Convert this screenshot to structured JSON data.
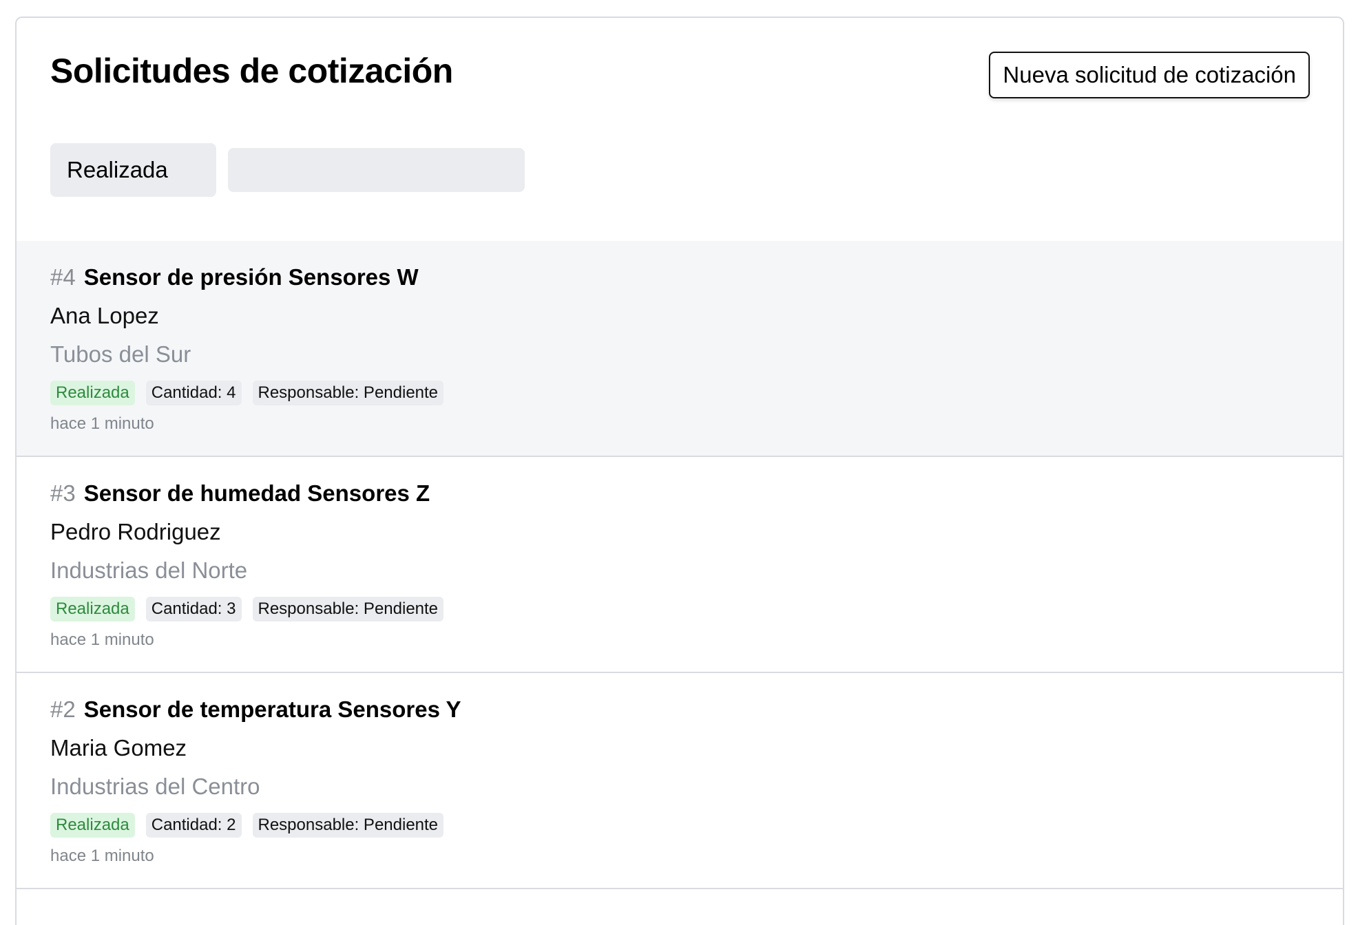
{
  "header": {
    "title": "Solicitudes de cotización",
    "new_button_label": "Nueva solicitud de cotización"
  },
  "filters": {
    "status_selected": "Realizada",
    "search_value": "",
    "search_placeholder": ""
  },
  "items": [
    {
      "number": "#4",
      "title": "Sensor de presión Sensores W",
      "person": "Ana Lopez",
      "company": "Tubos del Sur",
      "status": "Realizada",
      "quantity": "Cantidad: 4",
      "responsible": "Responsable: Pendiente",
      "time": "hace 1 minuto"
    },
    {
      "number": "#3",
      "title": "Sensor de humedad Sensores Z",
      "person": "Pedro Rodriguez",
      "company": "Industrias del Norte",
      "status": "Realizada",
      "quantity": "Cantidad: 3",
      "responsible": "Responsable: Pendiente",
      "time": "hace 1 minuto"
    },
    {
      "number": "#2",
      "title": "Sensor de temperatura Sensores Y",
      "person": "Maria Gomez",
      "company": "Industrias del Centro",
      "status": "Realizada",
      "quantity": "Cantidad: 2",
      "responsible": "Responsable: Pendiente",
      "time": "hace 1 minuto"
    }
  ],
  "colors": {
    "status_badge_bg": "#dcf5e0",
    "status_badge_text": "#2e8a3e",
    "hover_row_bg": "#f5f6f8"
  }
}
